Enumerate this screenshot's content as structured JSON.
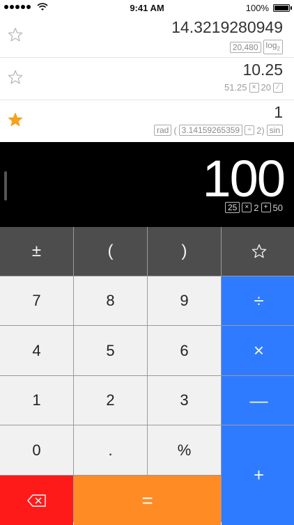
{
  "status_bar": {
    "time": "9:41 AM",
    "battery_percent": "100%"
  },
  "history": [
    {
      "starred": false,
      "result": "14.3219280949",
      "expression": [
        {
          "kind": "box",
          "text": "20,480"
        },
        {
          "kind": "box",
          "text": "log",
          "sub": "2"
        }
      ]
    },
    {
      "starred": false,
      "result": "10.25",
      "expression": [
        {
          "kind": "plain",
          "text": "51.25"
        },
        {
          "kind": "op",
          "text": "×"
        },
        {
          "kind": "plain",
          "text": "20"
        },
        {
          "kind": "op",
          "text": "⁄"
        }
      ]
    },
    {
      "starred": true,
      "result": "1",
      "expression": [
        {
          "kind": "box",
          "text": "rad"
        },
        {
          "kind": "plain",
          "text": "("
        },
        {
          "kind": "box",
          "text": "3.14159265359"
        },
        {
          "kind": "op",
          "text": "÷"
        },
        {
          "kind": "plain",
          "text": "2)"
        },
        {
          "kind": "box",
          "text": "sin"
        }
      ]
    }
  ],
  "display": {
    "value": "100",
    "expression": [
      {
        "kind": "box",
        "text": "25"
      },
      {
        "kind": "op",
        "text": "×"
      },
      {
        "kind": "plain",
        "text": "2"
      },
      {
        "kind": "op",
        "text": "+"
      },
      {
        "kind": "plain",
        "text": "50"
      }
    ]
  },
  "keys": {
    "plus_minus": "±",
    "open_paren": "(",
    "close_paren": ")",
    "seven": "7",
    "eight": "8",
    "nine": "9",
    "divide": "÷",
    "four": "4",
    "five": "5",
    "six": "6",
    "multiply": "×",
    "one": "1",
    "two": "2",
    "three": "3",
    "minus": "—",
    "zero": "0",
    "decimal": ".",
    "percent": "%",
    "plus": "+",
    "equals": "="
  },
  "colors": {
    "star_active": "#f4a31c",
    "star_inactive": "#b8b8b8",
    "operator_blue": "#2f7bff",
    "equals_orange": "#ff8b25",
    "backspace_red": "#ff1a1a",
    "function_gray": "#4d4d4d"
  }
}
